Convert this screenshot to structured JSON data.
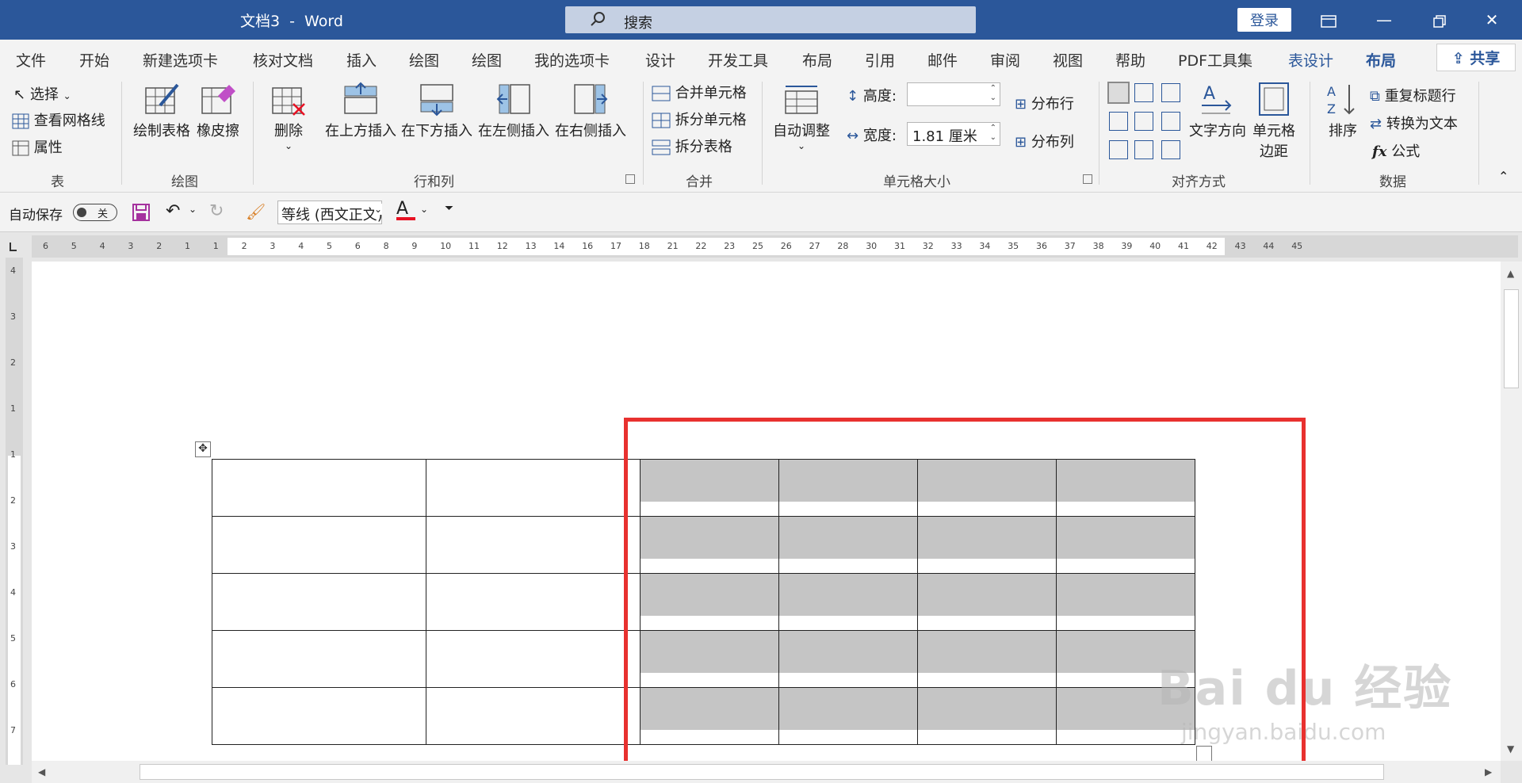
{
  "app": {
    "document_name": "文档3",
    "separator": "-",
    "app_name": "Word",
    "search_placeholder": "搜索",
    "login_label": "登录",
    "window_controls": [
      "restore-window-icon",
      "minimize-icon",
      "maximize-icon",
      "close-icon"
    ]
  },
  "menu": {
    "tabs": [
      "文件",
      "开始",
      "新建选项卡",
      "核对文档",
      "插入",
      "绘图",
      "绘图",
      "我的选项卡",
      "设计",
      "开发工具",
      "布局",
      "引用",
      "邮件",
      "审阅",
      "视图",
      "帮助",
      "PDF工具集",
      "表设计",
      "布局"
    ],
    "active_tab_index": 18,
    "share_label": "共享"
  },
  "ribbon": {
    "table": {
      "select": "选择",
      "view_gridlines": "查看网格线",
      "properties": "属性",
      "group": "表"
    },
    "draw": {
      "draw_table": "绘制表格",
      "eraser": "橡皮擦",
      "group": "绘图"
    },
    "rows_cols": {
      "delete": "删除",
      "insert_above": "在上方插入",
      "insert_below": "在下方插入",
      "insert_left": "在左侧插入",
      "insert_right": "在右侧插入",
      "group": "行和列"
    },
    "merge": {
      "merge_cells": "合并单元格",
      "split_cells": "拆分单元格",
      "split_table": "拆分表格",
      "group": "合并"
    },
    "cell_size": {
      "autofit": "自动调整",
      "height_label": "高度:",
      "height_value": "",
      "width_label": "宽度:",
      "width_value": "1.81 厘米",
      "distribute_rows": "分布行",
      "distribute_cols": "分布列",
      "group": "单元格大小"
    },
    "alignment": {
      "text_direction": "文字方向",
      "cell_margins_line1": "单元格",
      "cell_margins_line2": "边距",
      "group": "对齐方式"
    },
    "data": {
      "sort": "排序",
      "repeat_header": "重复标题行",
      "convert_to_text": "转换为文本",
      "formula": "公式",
      "group": "数据"
    }
  },
  "qat": {
    "autosave_label": "自动保存",
    "autosave_state": "关",
    "font_name": "等线 (西文正文)",
    "font_color": "#e81123"
  },
  "ruler": {
    "numbers": [
      "6",
      "5",
      "4",
      "3",
      "2",
      "1",
      "1",
      "2",
      "3",
      "4",
      "5",
      "6",
      "8",
      "9",
      "10",
      "11",
      "12",
      "13",
      "14",
      "16",
      "17",
      "18",
      "21",
      "22",
      "23",
      "25",
      "26",
      "27",
      "28",
      "30",
      "31",
      "32",
      "33",
      "34",
      "35",
      "36",
      "37",
      "38",
      "39",
      "40",
      "41",
      "42",
      "43",
      "44",
      "45"
    ],
    "vertical_numbers": [
      "4",
      "3",
      "2",
      "1",
      "1",
      "2",
      "3",
      "4",
      "5",
      "6",
      "7"
    ]
  },
  "table": {
    "rows": 5,
    "columns": 6,
    "selected_columns": [
      2,
      3,
      4,
      5
    ]
  },
  "watermark": {
    "brand": "Bai du 经验",
    "url": "jingyan.baidu.com"
  },
  "colors": {
    "title_bar": "#2b579a",
    "highlight": "#e8312f",
    "selection": "#c5c5c5"
  }
}
